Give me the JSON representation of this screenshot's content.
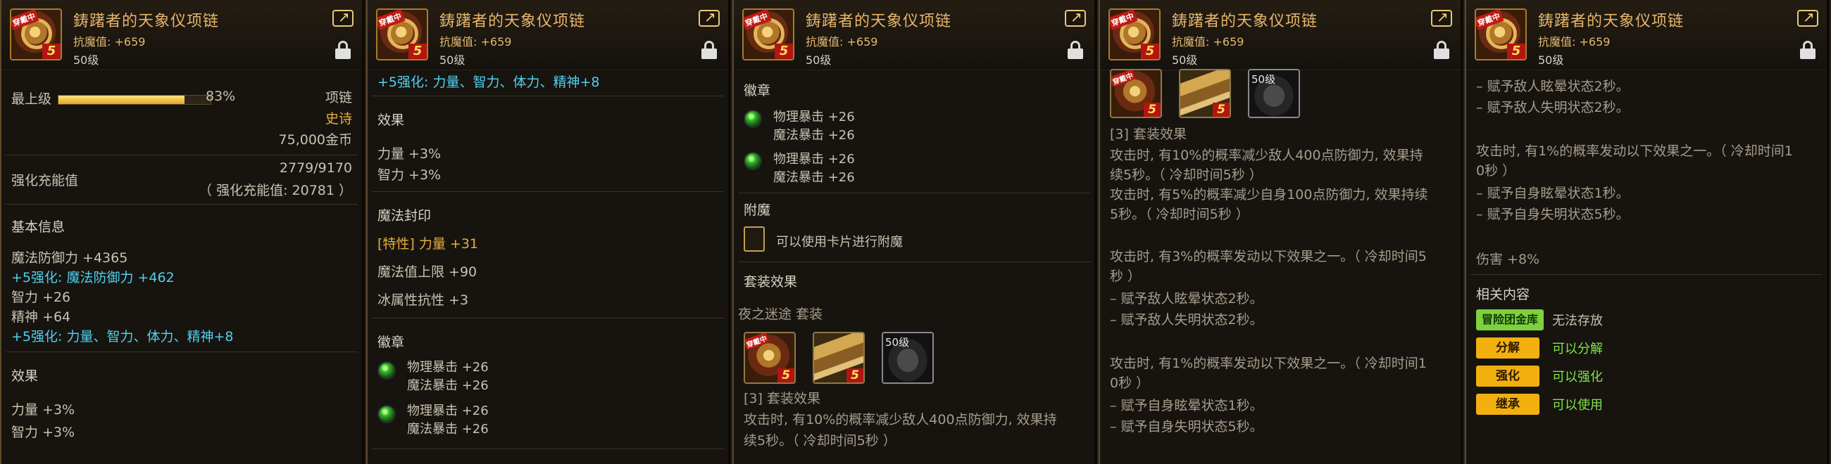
{
  "item": {
    "name": "鋳躇者的天象仪项链",
    "resist": "抗魔值: +659",
    "level": "50级",
    "icon_tag": "穿戴中",
    "icon_grade": "5"
  },
  "panel1": {
    "max_grade_label": "最上级",
    "max_grade_percent": "83%",
    "max_grade_fill": 0.83,
    "slot": "项链",
    "rarity": "史诗",
    "price": "75,000金币",
    "amp_label": "强化充能值",
    "amp_value": "2779/9170",
    "amp_extra": "（ 强化充能值: 20781 ）",
    "basic_title": "基本信息",
    "basic": [
      "魔法防御力 +4365",
      "+5强化: 魔法防御力 +462",
      "智力 +26",
      "精神 +64",
      "+5强化: 力量、智力、体力、精神+8"
    ],
    "effect_title": "效果",
    "effects": [
      "力量 +3%",
      "智力 +3%"
    ]
  },
  "panel2": {
    "enhance": "+5强化: 力量、智力、体力、精神+8",
    "effect_title": "效果",
    "effects": [
      "力量 +3%",
      "智力 +3%"
    ],
    "seal_title": "魔法封印",
    "seal_items": [
      "[特性] 力量 +31",
      "魔法值上限 +90",
      "冰属性抗性 +3"
    ],
    "badge_title": "徽章",
    "badges": [
      [
        "物理暴击 +26",
        "魔法暴击 +26"
      ],
      [
        "物理暴击 +26",
        "魔法暴击 +26"
      ]
    ]
  },
  "panel3": {
    "badge_title": "徽章",
    "badges": [
      [
        "物理暴击 +26",
        "魔法暴击 +26"
      ],
      [
        "物理暴击 +26",
        "魔法暴击 +26"
      ]
    ],
    "enchant_title": "附魔",
    "enchant_text": "可以使用卡片进行附魔",
    "set_title": "套装效果",
    "set_name": "夜之迷途  套装",
    "set_icon_level": "50级",
    "set_effect_title": "[3] 套装效果",
    "set_effect_lines": [
      "攻击时, 有10%的概率减少敌人400点防御力, 效果持",
      "续5秒。（ 冷却时间5秒 ）"
    ]
  },
  "panel4": {
    "set_icon_level": "50级",
    "set_effect_title": "[3] 套装效果",
    "lines": [
      "攻击时, 有10%的概率减少敌人400点防御力, 效果持",
      "续5秒。（ 冷却时间5秒 ）",
      "攻击时, 有5%的概率减少自身100点防御力, 效果持续",
      "5秒。（ 冷却时间5秒 ）",
      "",
      "攻击时, 有3%的概率发动以下效果之一。（ 冷却时间5",
      "秒 ）",
      "– 赋予敌人眩晕状态2秒。",
      "– 赋予敌人失明状态2秒。",
      "",
      "攻击时, 有1%的概率发动以下效果之一。（ 冷却时间1",
      "0秒 ）",
      "– 赋予自身眩晕状态1秒。",
      "– 赋予自身失明状态5秒。"
    ]
  },
  "panel5": {
    "lines": [
      "– 赋予敌人眩晕状态2秒。",
      "– 赋予敌人失明状态2秒。",
      "",
      "攻击时, 有1%的概率发动以下效果之一。（ 冷却时间1",
      "0秒 ）",
      "– 赋予自身眩晕状态1秒。",
      "– 赋予自身失明状态5秒。",
      "",
      "伤害 +8%"
    ],
    "related_title": "相关内容",
    "actions": [
      {
        "label": "冒险团金库",
        "desc": "无法存放",
        "color": "#7fd03d"
      },
      {
        "label": "分解",
        "desc": "可以分解",
        "color": "#f2b00f"
      },
      {
        "label": "强化",
        "desc": "可以强化",
        "color": "#f2b00f"
      },
      {
        "label": "继承",
        "desc": "可以使用",
        "color": "#f2b00f"
      }
    ]
  },
  "colors": {
    "title": "#e7b56b",
    "cyan": "#4fd0f0",
    "orange": "#e7ac3e",
    "green_text": "#7fe34a"
  }
}
